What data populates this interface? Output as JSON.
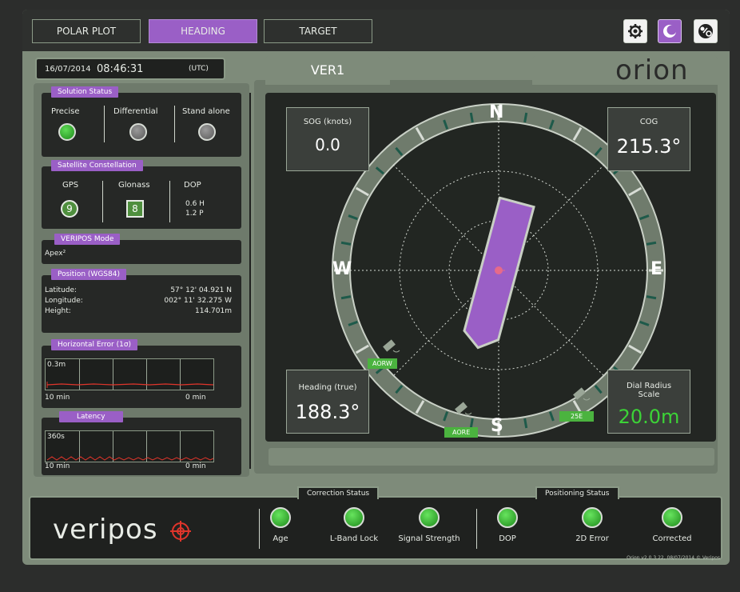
{
  "tabs": [
    {
      "label": "POLAR PLOT",
      "active": false
    },
    {
      "label": "HEADING",
      "active": true
    },
    {
      "label": "TARGET",
      "active": false
    }
  ],
  "toolbar_icons": [
    "gear-icon",
    "moon-icon",
    "tools-icon"
  ],
  "datetime": {
    "date": "16/07/2014",
    "time": "08:46:31",
    "zone": "(UTC)"
  },
  "solution_status": {
    "title": "Solution Status",
    "items": [
      {
        "label": "Precise",
        "state": "on"
      },
      {
        "label": "Differential",
        "state": "off"
      },
      {
        "label": "Stand alone",
        "state": "off"
      }
    ]
  },
  "satellite": {
    "title": "Satellite Constellation",
    "gps_label": "GPS",
    "gps_value": "9",
    "glonass_label": "Glonass",
    "glonass_value": "8",
    "dop_label": "DOP",
    "dop_h": "0.6 H",
    "dop_p": "1.2 P"
  },
  "veripos_mode": {
    "title": "VERIPOS Mode",
    "value": "Apex²"
  },
  "position": {
    "title": "Position  (WGS84)",
    "rows": [
      {
        "label": "Latitude:",
        "value": "57°  12'  04.921   N"
      },
      {
        "label": "Longitude:",
        "value": "002°  11'  32.275   W"
      },
      {
        "label": "Height:",
        "value": "114.701m"
      }
    ]
  },
  "horiz_error": {
    "title": "Horizontal Error (1σ)",
    "scale": "0.3m",
    "left": "10 min",
    "right": "0 min"
  },
  "latency": {
    "title": "Latency",
    "scale": "360s",
    "left": "10 min",
    "right": "0 min"
  },
  "vessel": {
    "name": "VER1",
    "brand": "orion"
  },
  "sog": {
    "label": "SOG (knots)",
    "value": "0.0"
  },
  "cog": {
    "label": "COG",
    "value": "215.3°"
  },
  "heading": {
    "label": "Heading (true)",
    "value": "188.3°",
    "degrees": 188.3
  },
  "dial_scale": {
    "label": "Dial Radius Scale",
    "value": "20.0m"
  },
  "compass": {
    "n": "N",
    "e": "E",
    "s": "S",
    "w": "W"
  },
  "satellites": [
    {
      "tag": "AORW"
    },
    {
      "tag": "AORE"
    },
    {
      "tag": "25E"
    }
  ],
  "bottom": {
    "logo": "veripos",
    "correction_title": "Correction Status",
    "positioning_title": "Positioning Status",
    "indicators": [
      "Age",
      "L-Band Lock",
      "Signal Strength",
      "DOP",
      "2D Error",
      "Corrected"
    ],
    "version": "Orion v2.0.3.22, 08/07/2014 © Veripos"
  },
  "colors": {
    "accent": "#9a5fc6",
    "good": "#3cc336",
    "frame": "#7e8b7a"
  }
}
